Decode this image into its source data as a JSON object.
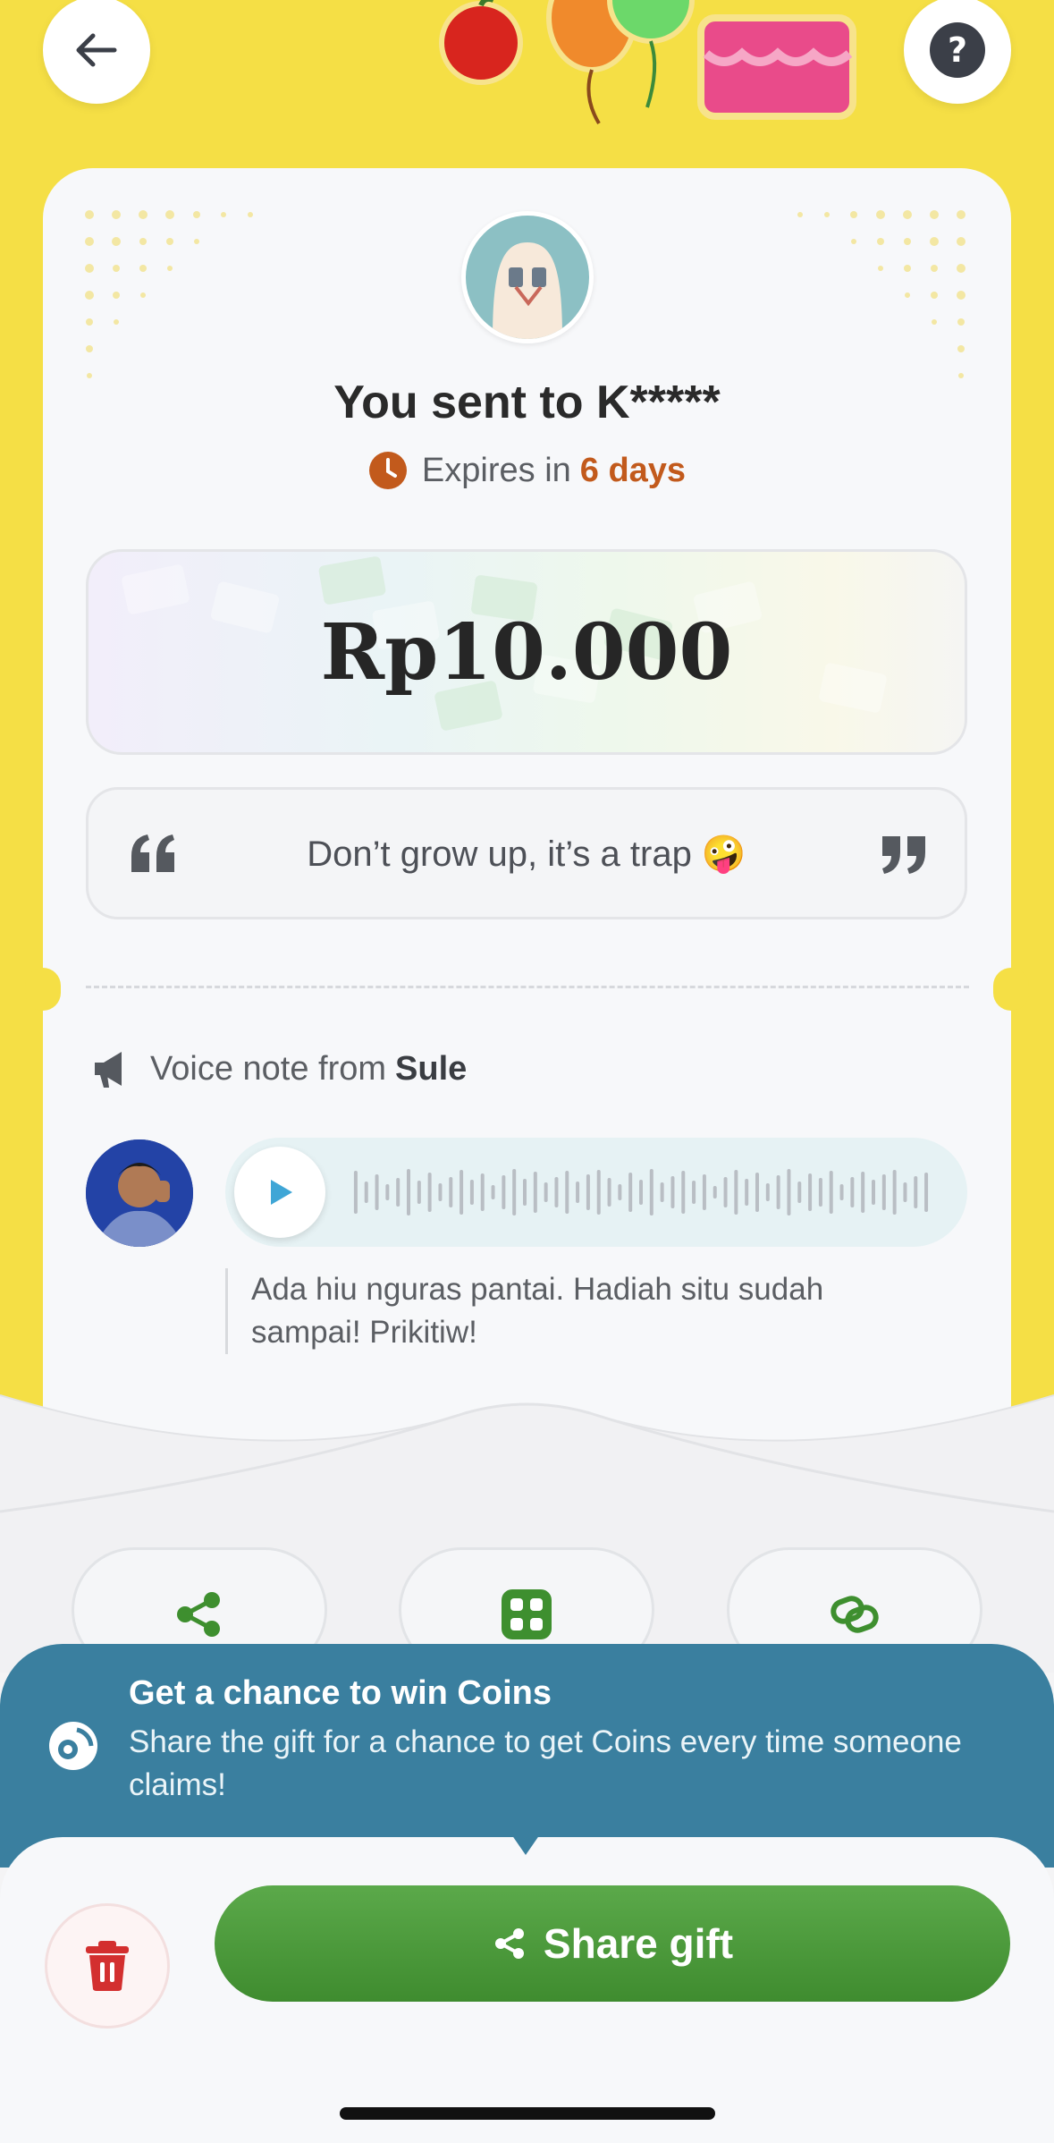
{
  "header": {
    "back_icon": "arrow-left-icon",
    "help_label": "?"
  },
  "gift": {
    "title": "You sent to K*****",
    "expires_prefix": "Expires in",
    "expires_value": "6 days",
    "amount": "Rp10.000",
    "message": "Don’t grow up, it’s a trap 🤪"
  },
  "voice_note": {
    "label_prefix": "Voice note from",
    "sender": "Sule",
    "transcript": "Ada hiu nguras pantai. Hadiah situ sudah sampai! Prikitiw!"
  },
  "actions": [
    {
      "icon": "share-icon"
    },
    {
      "icon": "qr-code-icon"
    },
    {
      "icon": "link-icon"
    }
  ],
  "coins_banner": {
    "title": "Get a chance to win Coins",
    "description": "Share the gift for a chance to get Coins every time someone claims!"
  },
  "footer": {
    "share_label": "Share gift",
    "delete_icon": "trash-icon"
  },
  "colors": {
    "background_yellow": "#f5df45",
    "accent_green": "#3f8c2f",
    "banner_blue": "#3a7f9f",
    "expire_orange": "#c25a1c",
    "delete_red": "#d32f2f"
  }
}
